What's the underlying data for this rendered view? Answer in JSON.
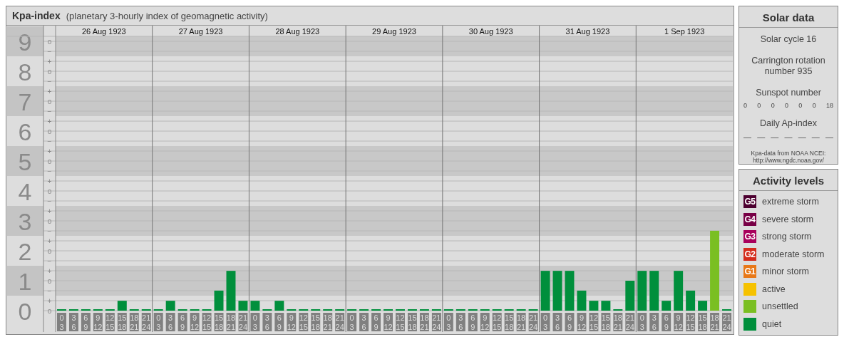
{
  "header": {
    "title": "Kpa-index",
    "subtitle": "(planetary 3-hourly index of geomagnetic activity)"
  },
  "days": [
    {
      "date": "26 Aug 1923",
      "slots": [
        {
          "from": "0",
          "to": "3"
        },
        {
          "from": "3",
          "to": "6"
        },
        {
          "from": "6",
          "to": "9"
        },
        {
          "from": "9",
          "to": "12"
        },
        {
          "from": "12",
          "to": "15"
        },
        {
          "from": "15",
          "to": "18"
        },
        {
          "from": "18",
          "to": "21"
        },
        {
          "from": "21",
          "to": "24"
        }
      ]
    },
    {
      "date": "27 Aug 1923",
      "slots": [
        {
          "from": "0",
          "to": "3"
        },
        {
          "from": "3",
          "to": "6"
        },
        {
          "from": "6",
          "to": "9"
        },
        {
          "from": "9",
          "to": "12"
        },
        {
          "from": "12",
          "to": "15"
        },
        {
          "from": "15",
          "to": "18"
        },
        {
          "from": "18",
          "to": "21"
        },
        {
          "from": "21",
          "to": "24"
        }
      ]
    },
    {
      "date": "28 Aug 1923",
      "slots": [
        {
          "from": "0",
          "to": "3"
        },
        {
          "from": "3",
          "to": "6"
        },
        {
          "from": "6",
          "to": "9"
        },
        {
          "from": "9",
          "to": "12"
        },
        {
          "from": "12",
          "to": "15"
        },
        {
          "from": "15",
          "to": "18"
        },
        {
          "from": "18",
          "to": "21"
        },
        {
          "from": "21",
          "to": "24"
        }
      ]
    },
    {
      "date": "29 Aug 1923",
      "slots": [
        {
          "from": "0",
          "to": "3"
        },
        {
          "from": "3",
          "to": "6"
        },
        {
          "from": "6",
          "to": "9"
        },
        {
          "from": "9",
          "to": "12"
        },
        {
          "from": "12",
          "to": "15"
        },
        {
          "from": "15",
          "to": "18"
        },
        {
          "from": "18",
          "to": "21"
        },
        {
          "from": "21",
          "to": "24"
        }
      ]
    },
    {
      "date": "30 Aug 1923",
      "slots": [
        {
          "from": "0",
          "to": "3"
        },
        {
          "from": "3",
          "to": "6"
        },
        {
          "from": "6",
          "to": "9"
        },
        {
          "from": "9",
          "to": "12"
        },
        {
          "from": "12",
          "to": "15"
        },
        {
          "from": "15",
          "to": "18"
        },
        {
          "from": "18",
          "to": "21"
        },
        {
          "from": "21",
          "to": "24"
        }
      ]
    },
    {
      "date": "31 Aug 1923",
      "slots": [
        {
          "from": "0",
          "to": "3"
        },
        {
          "from": "3",
          "to": "6"
        },
        {
          "from": "6",
          "to": "9"
        },
        {
          "from": "9",
          "to": "12"
        },
        {
          "from": "12",
          "to": "15"
        },
        {
          "from": "15",
          "to": "18"
        },
        {
          "from": "18",
          "to": "21"
        },
        {
          "from": "21",
          "to": "24"
        }
      ]
    },
    {
      "date": "1 Sep 1923",
      "slots": [
        {
          "from": "0",
          "to": "3"
        },
        {
          "from": "3",
          "to": "6"
        },
        {
          "from": "6",
          "to": "9"
        },
        {
          "from": "9",
          "to": "12"
        },
        {
          "from": "12",
          "to": "15"
        },
        {
          "from": "15",
          "to": "18"
        },
        {
          "from": "18",
          "to": "21"
        },
        {
          "from": "21",
          "to": "24"
        }
      ]
    }
  ],
  "chart_data": {
    "type": "bar",
    "ylim": [
      0,
      9
    ],
    "bands": [
      {
        "axis": "y",
        "from": 0.5,
        "to": 1.5
      },
      {
        "axis": "y",
        "from": 2.5,
        "to": 3.5
      },
      {
        "axis": "y",
        "from": 4.5,
        "to": 5.5
      },
      {
        "axis": "y",
        "from": 6.5,
        "to": 7.5
      },
      {
        "axis": "y",
        "from": 8.5,
        "to": 9
      }
    ],
    "yticks": [
      {
        "value": 0,
        "label": "0"
      },
      {
        "value": 1,
        "label": "1"
      },
      {
        "value": 2,
        "label": "2"
      },
      {
        "value": 3,
        "label": "3"
      },
      {
        "value": 4,
        "label": "4"
      },
      {
        "value": 5,
        "label": "5"
      },
      {
        "value": 6,
        "label": "6"
      },
      {
        "value": 7,
        "label": "7"
      },
      {
        "value": 8,
        "label": "8"
      },
      {
        "value": 9,
        "label": "9"
      }
    ],
    "grid": true,
    "series": [
      {
        "color": "#008f3c",
        "values": [
          0,
          0,
          0,
          0,
          0,
          0.33,
          0,
          0,
          0,
          0.33,
          0,
          0,
          0,
          0.67,
          1.33,
          0.33,
          0.33,
          0,
          0.33,
          0,
          0,
          0,
          0,
          0,
          0,
          0,
          0,
          0,
          0,
          0,
          0,
          0,
          0,
          0,
          0,
          0,
          0,
          0,
          0,
          0,
          1.33,
          1.33,
          1.33,
          0.67,
          0.33,
          0.33,
          0,
          1,
          1.33,
          1.33,
          0.33,
          1.33,
          0.67,
          0.33,
          null,
          0
        ]
      },
      {
        "color": "#7abf22",
        "values": [
          null,
          null,
          null,
          null,
          null,
          null,
          null,
          null,
          null,
          null,
          null,
          null,
          null,
          null,
          null,
          null,
          null,
          null,
          null,
          null,
          null,
          null,
          null,
          null,
          null,
          null,
          null,
          null,
          null,
          null,
          null,
          null,
          null,
          null,
          null,
          null,
          null,
          null,
          null,
          null,
          null,
          null,
          null,
          null,
          null,
          null,
          null,
          null,
          null,
          null,
          null,
          null,
          null,
          null,
          2.67,
          null
        ]
      }
    ]
  },
  "y_axis_minor": [
    "o",
    "−",
    "+",
    "o",
    "−",
    "+",
    "o",
    "−",
    "+",
    "o",
    "−",
    "+",
    "o",
    "−",
    "+",
    "o",
    "−",
    "+",
    "o",
    "−",
    "+",
    "o",
    "−",
    "+",
    "o",
    "−",
    "+",
    "o"
  ],
  "solar": {
    "title": "Solar data",
    "cycle": "Solar cycle 16",
    "carrington": "Carrington rotation number 935",
    "sunspot_label": "Sunspot number",
    "sunspots": [
      "0",
      "0",
      "0",
      "0",
      "0",
      "0",
      "18"
    ],
    "ap_label": "Daily Ap-index",
    "ap": [
      "—",
      "—",
      "—",
      "—",
      "—",
      "—",
      "—"
    ],
    "credit": [
      "Kpa-data from NOAA NCEI:",
      "http://www.ngdc.noaa.gov/"
    ]
  },
  "legend": {
    "title": "Activity levels",
    "items": [
      {
        "badge": "G5",
        "label": "extreme storm",
        "color": "#4d0030"
      },
      {
        "badge": "G4",
        "label": "severe storm",
        "color": "#780046"
      },
      {
        "badge": "G3",
        "label": "strong storm",
        "color": "#a8005c"
      },
      {
        "badge": "G2",
        "label": "moderate storm",
        "color": "#d42c1c"
      },
      {
        "badge": "G1",
        "label": "minor storm",
        "color": "#e87818"
      },
      {
        "label": "active",
        "color": "#f6c200"
      },
      {
        "label": "unsettled",
        "color": "#7abf22"
      },
      {
        "label": "quiet",
        "color": "#008f3c"
      }
    ]
  }
}
